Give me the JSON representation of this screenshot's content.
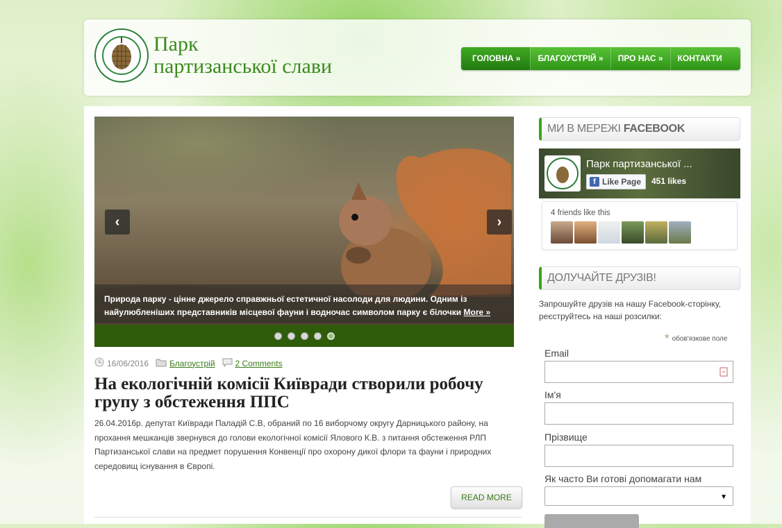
{
  "site": {
    "title_line1": "Парк",
    "title_line2": "партизанської слави"
  },
  "nav": {
    "items": [
      {
        "label": "ГОЛОВНА »"
      },
      {
        "label": "БЛАГОУСТРІЙ »"
      },
      {
        "label": "ПРО НАС »"
      },
      {
        "label": "КОНТАКТИ"
      }
    ]
  },
  "slider": {
    "caption": "Природа парку - цінне джерело справжньої естетичної насолоди для людини. Одним із найулюбленіших представників місцевої фауни і водночас символом парку є білочки",
    "more_label": "More »",
    "prev_icon": "chevron-left-icon",
    "next_icon": "chevron-right-icon",
    "slide_count": 5,
    "active_slide": 5
  },
  "post": {
    "date": "16/06/2016",
    "category": "Благоустрій",
    "comments": "2 Comments",
    "title": "На екологічній комісії Київради створили робочу групу з обстеження ППС",
    "body": "26.04.2016р. депутат Київради Паладій С.В, обраний по 16 виборчому округу Дарницького району, на прохання мешканців звернувся до голови екологічної комісії Ялового К.В. з питання обстеження РЛП Партизанської слави на предмет порушення Конвенції про охорону дикої флори та фауни і природних середовищ існування в Європі.",
    "read_more": "READ MORE"
  },
  "facebook_widget": {
    "title_regular": "МИ В МЕРЕЖІ ",
    "title_bold": "FACEBOOK",
    "page_name": "Парк партизанської ...",
    "like_label": "Like Page",
    "likes": "451 likes",
    "friends_text": "4 friends like this"
  },
  "signup_widget": {
    "title": "ДОЛУЧАЙТЕ ДРУЗІВ!",
    "text": "Запрошуйте друзів на нашу Facebook-сторінку, реєструйтесь на наші розсилки:",
    "required_note": "обов'язкове поле",
    "email_label": "Email",
    "first_name_label": "Ім'я",
    "last_name_label": "Прізвище",
    "frequency_label": "Як часто Ви готові допомагати нам"
  },
  "colors": {
    "brand_green": "#3b8a1c",
    "nav_green": "#4cb02a",
    "slider_dark_green": "#2f5c0a"
  }
}
